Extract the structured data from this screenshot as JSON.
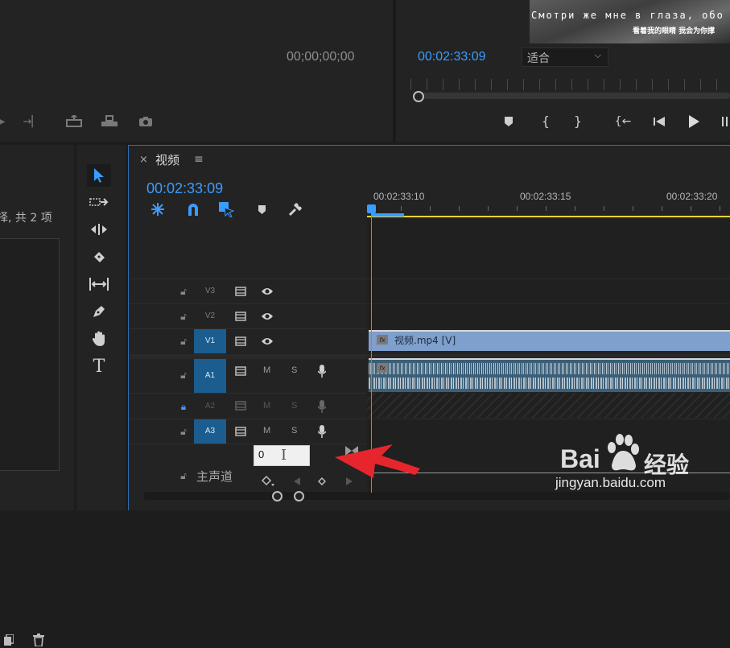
{
  "source_monitor": {
    "timecode": "00;00;00;00"
  },
  "program_monitor": {
    "timecode": "00:02:33:09",
    "fit_select": "适合",
    "subtitle_line1": "Смотри же мне в глаза, обо все",
    "subtitle_line2": "看着我的眼睛 我会为你撑"
  },
  "project_panel": {
    "item_count_fragment": "择, 共 2 项"
  },
  "timeline": {
    "tab_title": "视频",
    "timecode": "00:02:33:09",
    "ruler_ticks": [
      "00:02:33:10",
      "00:02:33:15",
      "00:02:33:20"
    ],
    "video_tracks": [
      {
        "name": "V3",
        "targeted": false
      },
      {
        "name": "V2",
        "targeted": false
      },
      {
        "name": "V1",
        "targeted": true
      }
    ],
    "audio_tracks": [
      {
        "name": "A1",
        "m": "M",
        "s": "S",
        "targeted": true
      },
      {
        "name": "A2",
        "m": "M",
        "s": "S",
        "targeted": false
      },
      {
        "name": "A3",
        "m": "M",
        "s": "S",
        "targeted": true
      }
    ],
    "clip_v1_label": "视频.mp4 [V]",
    "master_label": "主声道",
    "master_input_value": "0"
  },
  "watermark": {
    "brand": "Bai",
    "brand2": "经验",
    "url": "jingyan.baidu.com"
  },
  "colors": {
    "accent_blue": "#3b9cff",
    "clip_video": "#7f9fcc",
    "clip_audio": "#3b5f78",
    "arrow_red": "#e6262c",
    "track_target": "#1b5d8f"
  }
}
